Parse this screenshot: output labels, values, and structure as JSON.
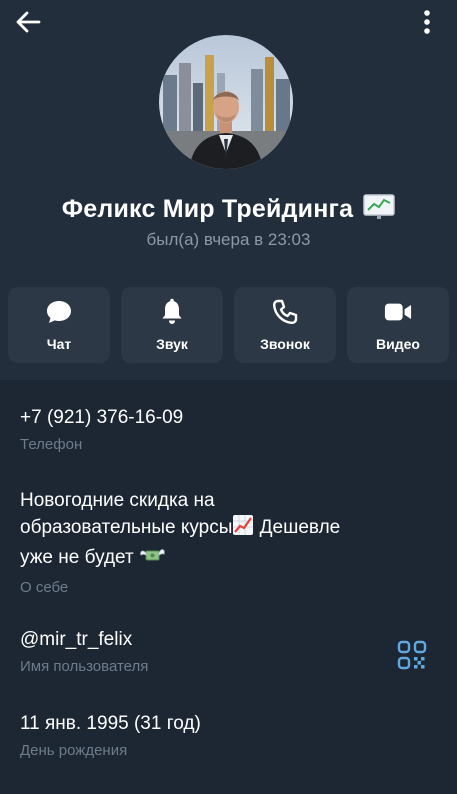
{
  "header": {
    "back_icon": "arrow-left-icon",
    "menu_icon": "more-vertical-icon",
    "name": "Феликс Мир Трейдинга",
    "name_badge_icon": "chart-emoji-icon",
    "status": "был(а) вчера в 23:03"
  },
  "actions": [
    {
      "label": "Чат",
      "icon": "chat-bubble-icon"
    },
    {
      "label": "Звук",
      "icon": "bell-icon"
    },
    {
      "label": "Звонок",
      "icon": "phone-icon"
    },
    {
      "label": "Видео",
      "icon": "video-camera-icon"
    }
  ],
  "info": {
    "phone": {
      "value": "+7 (921) 376-16-09",
      "label": "Телефон"
    },
    "about": {
      "line1": "Новогодние скидка на",
      "line2": "образовательные курсы",
      "line2_tail": " Дешевле",
      "line3": "уже не будет ",
      "label": "О себе"
    },
    "username": {
      "value": "@mir_tr_felix",
      "label": "Имя пользователя"
    },
    "birthday": {
      "value": "11 янв. 1995 (31 год)",
      "label": "День рождения"
    }
  },
  "colors": {
    "background": "#1d2733",
    "header": "#232e3c",
    "button": "#2c3845",
    "accent": "#5fa8e0",
    "secondary_text": "#8b99a7"
  }
}
